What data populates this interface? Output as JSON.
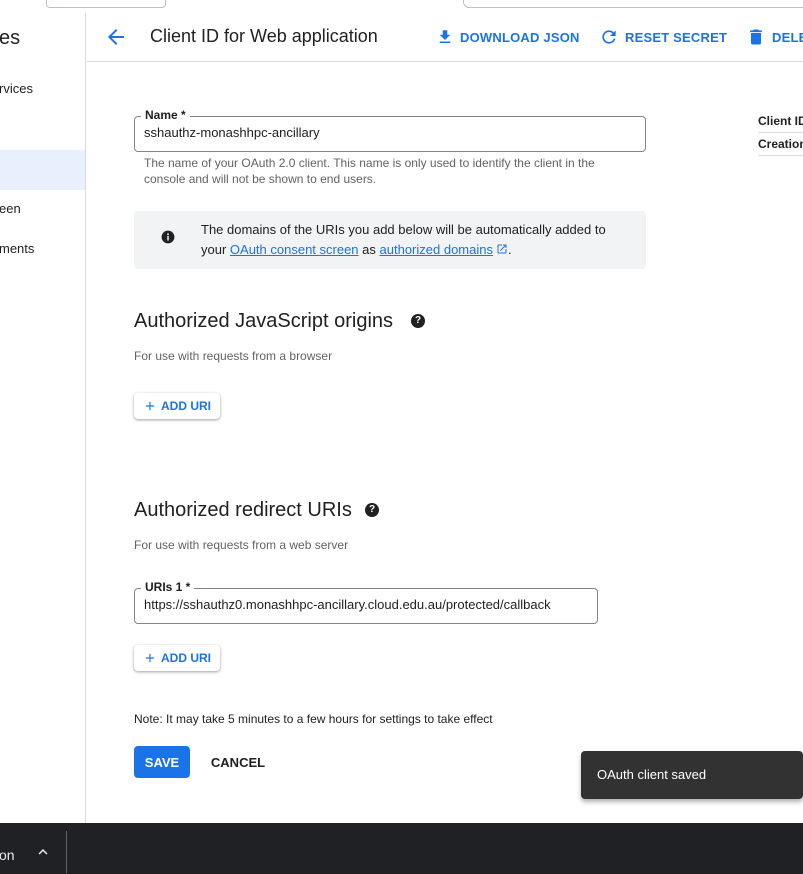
{
  "sidebar": {
    "title": "es",
    "items": [
      {
        "label": "rvices"
      },
      {
        "label": ""
      },
      {
        "label": "een"
      },
      {
        "label": "ments"
      }
    ]
  },
  "header": {
    "title": "Client ID for Web application",
    "actions": {
      "download": "DOWNLOAD JSON",
      "reset": "RESET SECRET",
      "delete": "DELE"
    }
  },
  "form": {
    "name": {
      "label": "Name *",
      "value": "sshauthz-monashhpc-ancillary",
      "hint": "The name of your OAuth 2.0 client. This name is only used to identify the client in the console and will not be shown to end users."
    },
    "info": {
      "text_before": "The domains of the URIs you add below will be automatically added to your ",
      "link1": "OAuth consent screen",
      "text_mid": " as ",
      "link2": "authorized domains",
      "text_after": "."
    },
    "js_origins": {
      "title": "Authorized JavaScript origins",
      "subtitle": "For use with requests from a browser",
      "add_label": "ADD URI"
    },
    "redirects": {
      "title": "Authorized redirect URIs",
      "subtitle": "For use with requests from a web server",
      "uri1_label": "URIs 1 *",
      "uri1_value": "https://sshauthz0.monashhpc-ancillary.cloud.edu.au/protected/callback",
      "add_label": "ADD URI"
    },
    "note": "Note: It may take 5 minutes to a few hours for settings to take effect",
    "save": "SAVE",
    "cancel": "CANCEL"
  },
  "right_info": {
    "row1": "Client ID",
    "row2": "Creation"
  },
  "snackbar": {
    "text": "OAuth client saved"
  },
  "bottom_bar": {
    "text": "on"
  },
  "colors": {
    "accent": "#1a73e8",
    "snackbar_bg": "#323232",
    "bottom_bar_bg": "#202124",
    "info_box_bg": "#f1f3f4"
  },
  "icons": [
    "back-arrow-icon",
    "download-icon",
    "refresh-icon",
    "trash-icon",
    "info-icon",
    "help-icon",
    "plus-icon",
    "external-link-icon",
    "chevron-up-icon"
  ]
}
